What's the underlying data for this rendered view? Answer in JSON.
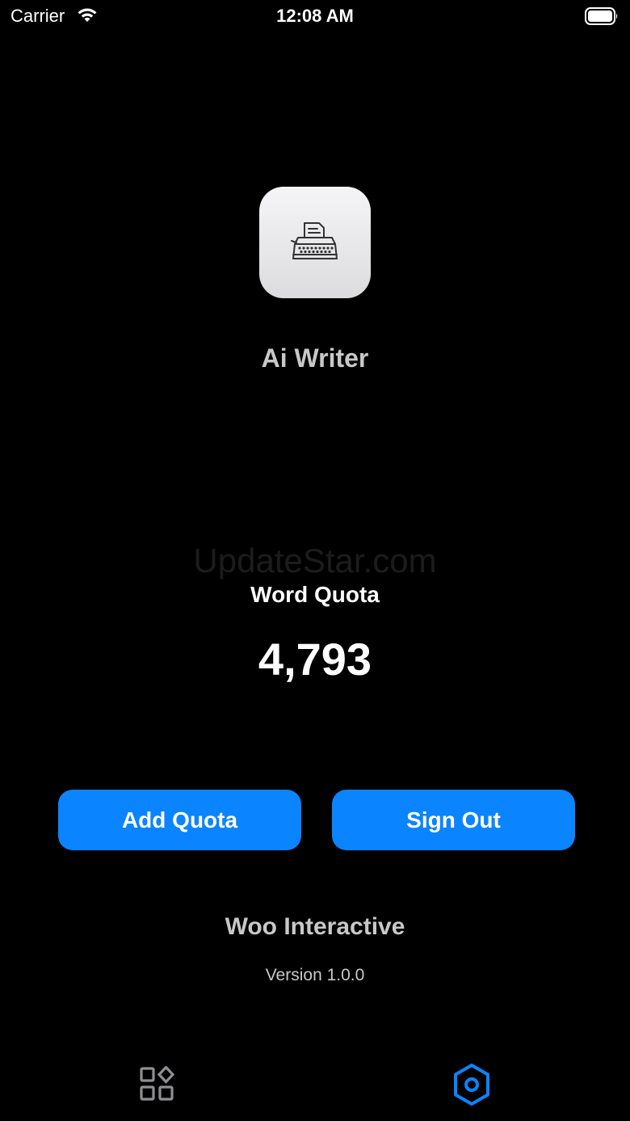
{
  "status_bar": {
    "carrier": "Carrier",
    "time": "12:08 AM",
    "icons": [
      "wifi-icon",
      "battery-icon"
    ]
  },
  "app": {
    "icon": "typewriter-icon",
    "name": "Ai Writer"
  },
  "watermark": "UpdateStar.com",
  "quota": {
    "label": "Word Quota",
    "value": "4,793"
  },
  "buttons": {
    "add_quota": "Add Quota",
    "sign_out": "Sign Out"
  },
  "footer": {
    "company": "Woo Interactive",
    "version": "Version 1.0.0"
  },
  "tab_bar": {
    "tabs": [
      {
        "icon": "grid-icon",
        "active": false
      },
      {
        "icon": "hexagon-gear-icon",
        "active": true
      }
    ]
  },
  "colors": {
    "background": "#000000",
    "accent": "#0a84ff",
    "inactive_tab": "#8e8e93",
    "secondary_text": "#c8c8c8"
  }
}
